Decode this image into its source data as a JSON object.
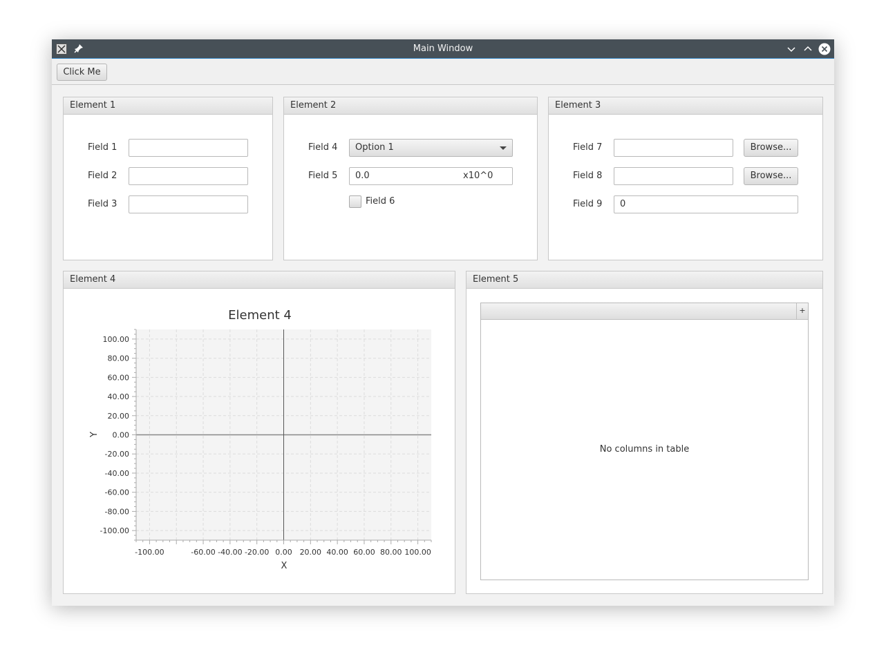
{
  "window": {
    "title": "Main Window"
  },
  "toolbar": {
    "click_me_label": "Click Me"
  },
  "element1": {
    "title": "Element 1",
    "fields": [
      {
        "label": "Field 1",
        "value": ""
      },
      {
        "label": "Field 2",
        "value": ""
      },
      {
        "label": "Field 3",
        "value": ""
      }
    ]
  },
  "element2": {
    "title": "Element 2",
    "field4": {
      "label": "Field 4",
      "selected": "Option 1"
    },
    "field5": {
      "label": "Field 5",
      "value": "0.0",
      "suffix": "x10^0"
    },
    "field6": {
      "label": "Field 6",
      "checked": false
    }
  },
  "element3": {
    "title": "Element 3",
    "field7": {
      "label": "Field 7",
      "value": "",
      "button": "Browse..."
    },
    "field8": {
      "label": "Field 8",
      "value": "",
      "button": "Browse..."
    },
    "field9": {
      "label": "Field 9",
      "value": "0"
    }
  },
  "element4": {
    "title": "Element 4"
  },
  "element5": {
    "title": "Element 5",
    "table_placeholder": "No columns in table"
  },
  "chart_data": {
    "type": "line",
    "title": "Element 4",
    "xlabel": "X",
    "ylabel": "Y",
    "xlim": [
      -110,
      110
    ],
    "ylim": [
      -110,
      110
    ],
    "x_ticks": [
      "-100.00",
      "-60.00",
      "-40.00",
      "-20.00",
      "0.00",
      "20.00",
      "40.00",
      "60.00",
      "80.00",
      "100.00"
    ],
    "y_ticks": [
      "100.00",
      "80.00",
      "60.00",
      "40.00",
      "20.00",
      "0.00",
      "-20.00",
      "-40.00",
      "-60.00",
      "-80.00",
      "-100.00"
    ],
    "series": [],
    "grid": true
  }
}
